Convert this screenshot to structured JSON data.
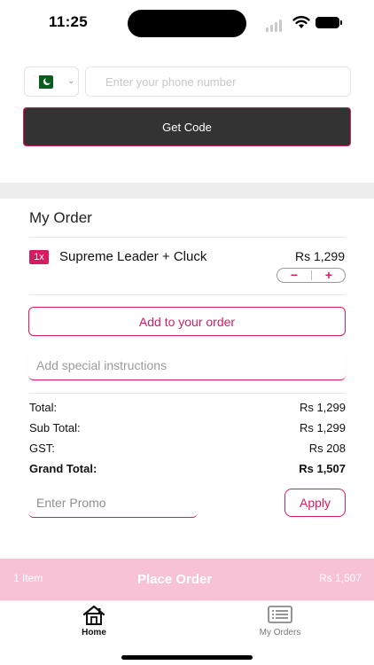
{
  "status_bar": {
    "time": "11:25"
  },
  "phone": {
    "country_flag": "pakistan-flag",
    "placeholder": "Enter your phone number",
    "get_code_label": "Get Code"
  },
  "order": {
    "title": "My Order",
    "items": [
      {
        "qty": "1x",
        "name": "Supreme Leader + Cluck",
        "price": "Rs 1,299"
      }
    ],
    "stepper": {
      "minus": "−",
      "plus": "+"
    },
    "add_label": "Add to your order",
    "special_placeholder": "Add special instructions"
  },
  "totals": {
    "total_label": "Total:",
    "total_value": "Rs 1,299",
    "subtotal_label": "Sub Total:",
    "subtotal_value": "Rs 1,299",
    "gst_label": "GST:",
    "gst_value": "Rs 208",
    "grand_label": "Grand Total:",
    "grand_value": "Rs 1,507"
  },
  "promo": {
    "placeholder": "Enter Promo",
    "apply_label": "Apply"
  },
  "place_order": {
    "items": "1 Item",
    "label": "Place Order",
    "total": "Rs 1,507"
  },
  "tabs": [
    {
      "label": "Home",
      "icon": "home-icon",
      "active": true
    },
    {
      "label": "My Orders",
      "icon": "orders-icon",
      "active": false
    }
  ],
  "colors": {
    "accent": "#d81b60",
    "button_dark": "#333333",
    "place_order_bg": "#f7c1d6",
    "divider": "#ededed"
  }
}
